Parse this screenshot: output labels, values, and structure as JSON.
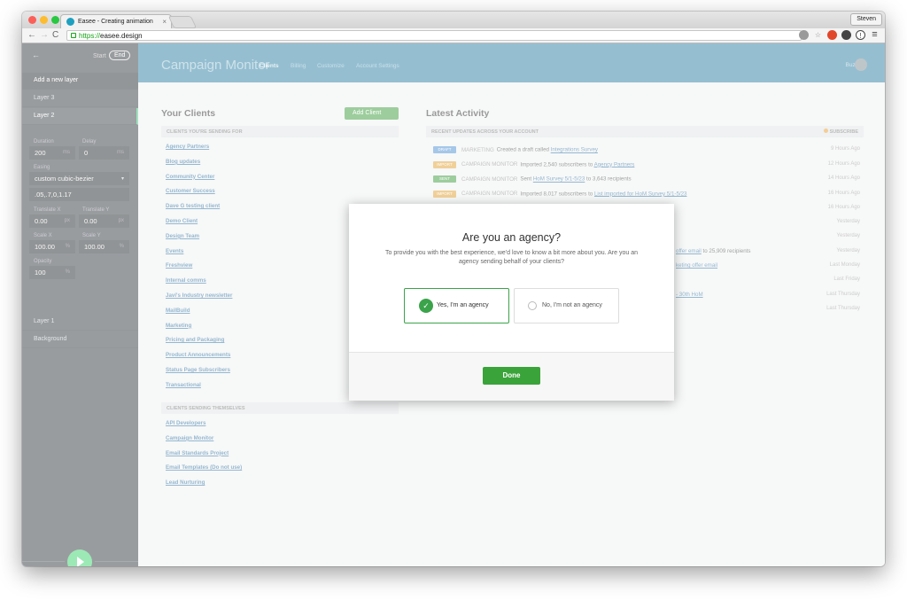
{
  "browser": {
    "tab_title": "Easee - Creating animation",
    "profile": "Steven",
    "url_scheme": "https://",
    "url_host": "easee.design"
  },
  "sidebar": {
    "back": "←",
    "start": "Start",
    "end": "End",
    "add_layer": "Add a new layer",
    "layer3": "Layer 3",
    "layer2": "Layer 2",
    "layer1": "Layer 1",
    "background": "Background",
    "duration_label": "Duration",
    "duration": "200",
    "ms": "ms",
    "delay_label": "Delay",
    "delay": "0",
    "easing_label": "Easing",
    "easing": "custom cubic-bezier",
    "bezier": ".05,.7,0,1.17",
    "tx_label": "Translate X",
    "tx": "0.00",
    "ty_label": "Translate Y",
    "ty": "0.00",
    "px": "px",
    "sx_label": "Scale X",
    "sx": "100.00",
    "sy_label": "Scale Y",
    "sy": "100.00",
    "pct": "%",
    "opacity_label": "Opacity",
    "opacity": "100"
  },
  "cm": {
    "logo": "Campaign Monitor",
    "nav": [
      "Clients",
      "Billing",
      "Customize",
      "Account Settings"
    ],
    "user": "Buzz",
    "your_clients": "Your Clients",
    "add_client": "Add Client",
    "sending_for": "CLIENTS YOU'RE SENDING FOR",
    "themselves": "CLIENTS SENDING THEMSELVES",
    "clients": [
      "Agency Partners",
      "Blog updates",
      "Community Center",
      "Customer Success",
      "Dave G testing client",
      "Demo Client",
      "Design Team",
      "Events",
      "Freshview",
      "Internal comms",
      "Javi's Industry newsletter",
      "MailBuild",
      "Marketing",
      "Pricing and Packaging",
      "Product Announcements",
      "Status Page Subscribers",
      "Transactional"
    ],
    "self_clients": [
      "API Developers",
      "Campaign Monitor",
      "Email Standards Project",
      "Email Templates (Do not use)",
      "Lead Nurturing"
    ],
    "latest": "Latest Activity",
    "recent": "RECENT UPDATES ACROSS YOUR ACCOUNT",
    "subscribe": "SUBSCRIBE",
    "activity": [
      {
        "badge": "DRAFT",
        "color": "#4a8fd1",
        "src": "MARKETING",
        "text": "Created a draft called ",
        "link": "Integrations Survey",
        "rest": "",
        "ago": "9 Hours Ago"
      },
      {
        "badge": "IMPORT",
        "color": "#e0a030",
        "src": "CAMPAIGN MONITOR",
        "text": "Imported 2,540 subscribers to ",
        "link": "Agency Partners",
        "rest": "",
        "ago": "12 Hours Ago"
      },
      {
        "badge": "SENT",
        "color": "#3b9b3b",
        "src": "CAMPAIGN MONITOR",
        "text": "Sent ",
        "link": "HoM Survey 5/1-5/23",
        "rest": " to 3,643 recipients",
        "ago": "14 Hours Ago"
      },
      {
        "badge": "IMPORT",
        "color": "#e0a030",
        "src": "CAMPAIGN MONITOR",
        "text": "Imported 8,017 subscribers to ",
        "link": "List imported for HoM Survey 5/1-5/23",
        "rest": "",
        "ago": "16 Hours Ago"
      },
      {
        "badge": "SENT",
        "color": "#3b9b3b",
        "src": "CUSTOMER SUCCESS",
        "text": "Sent ",
        "link": "Welcome Webinar -- Final -- blast 2",
        "rest": " to 1,189 recipients",
        "ago": "16 Hours Ago"
      }
    ],
    "partial": [
      {
        "link": "",
        "rest": "",
        "ago": "Yesterday"
      },
      {
        "link": "",
        "rest": "",
        "ago": "Yesterday"
      },
      {
        "link": "offer email",
        "rest": " to 25,909 recipients",
        "ago": "Yesterday"
      },
      {
        "link": "keting offer email",
        "rest": "",
        "ago": "Last Monday"
      },
      {
        "link": "",
        "rest": "",
        "ago": "Last Friday"
      },
      {
        "link": "- 30th HoM",
        "rest": "",
        "ago": "Last Thursday"
      },
      {
        "link": "",
        "rest": "",
        "ago": "Last Thursday"
      }
    ]
  },
  "modal": {
    "title": "Are you an agency?",
    "text": "To provide you with the best experience, we'd love to know a bit more about you. Are you an agency sending behalf of your clients?",
    "yes": "Yes, I'm an agency",
    "no": "No, I'm not an agency",
    "done": "Done"
  }
}
